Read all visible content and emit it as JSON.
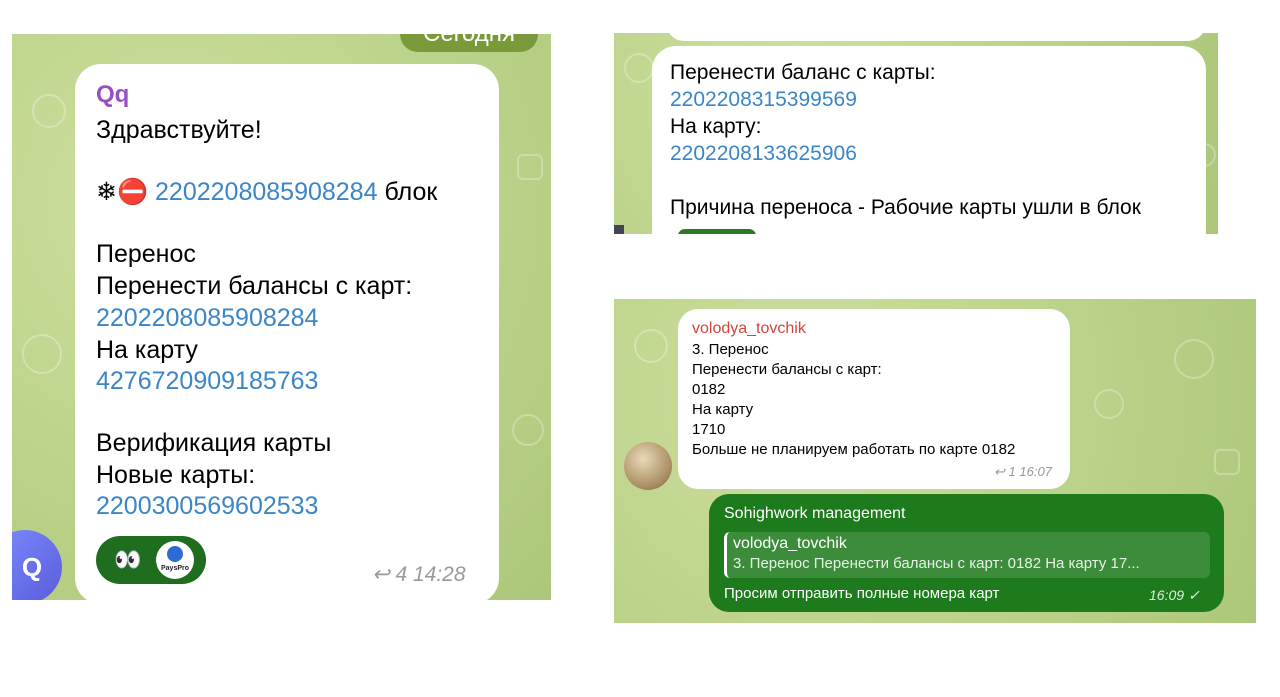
{
  "panel1": {
    "date_pill": "Сегодня",
    "sender": "Qq",
    "lines": [
      {
        "text": "Здравствуйте!"
      },
      {
        "prefix": "❄⛔",
        "num": "2202208085908284",
        "suffix": "блок"
      },
      {
        "text": "Перенос"
      },
      {
        "text": "Перенести балансы с карт:"
      },
      {
        "num": "2202208085908284"
      },
      {
        "text": "На карту"
      },
      {
        "num": "4276720909185763"
      },
      {
        "text": "Верификация карты"
      },
      {
        "text": "Новые карты:"
      },
      {
        "num": "2200300569602533"
      }
    ],
    "reaction_eyes": "👀",
    "reaction_app": "PaysPro",
    "reply_count": "4",
    "time": "14:28",
    "avatar_letter": "Q"
  },
  "panel2": {
    "lines": [
      {
        "text": "Перенести баланс с карты:"
      },
      {
        "num": "2202208315399569"
      },
      {
        "text": "На карту:"
      },
      {
        "num": "2202208133625906"
      },
      {
        "text": "Причина переноса - Рабочие карты ушли в блок"
      }
    ]
  },
  "panel3": {
    "msg1": {
      "sender": "volodya_tovchik",
      "lines": [
        "3. Перенос",
        "Перенести балансы с карт:",
        "0182",
        "На карту",
        "1710",
        "Больше не планируем работать по карте 0182"
      ],
      "reply_count": "1",
      "time": "16:07"
    },
    "msg2": {
      "sender": "Sohighwork management",
      "quote_name": "volodya_tovchik",
      "quote_text": "3. Перенос  Перенести балансы с карт: 0182 На карту  17...",
      "text": "Просим отправить полные номера карт",
      "time": "16:09",
      "check": "✓"
    }
  }
}
